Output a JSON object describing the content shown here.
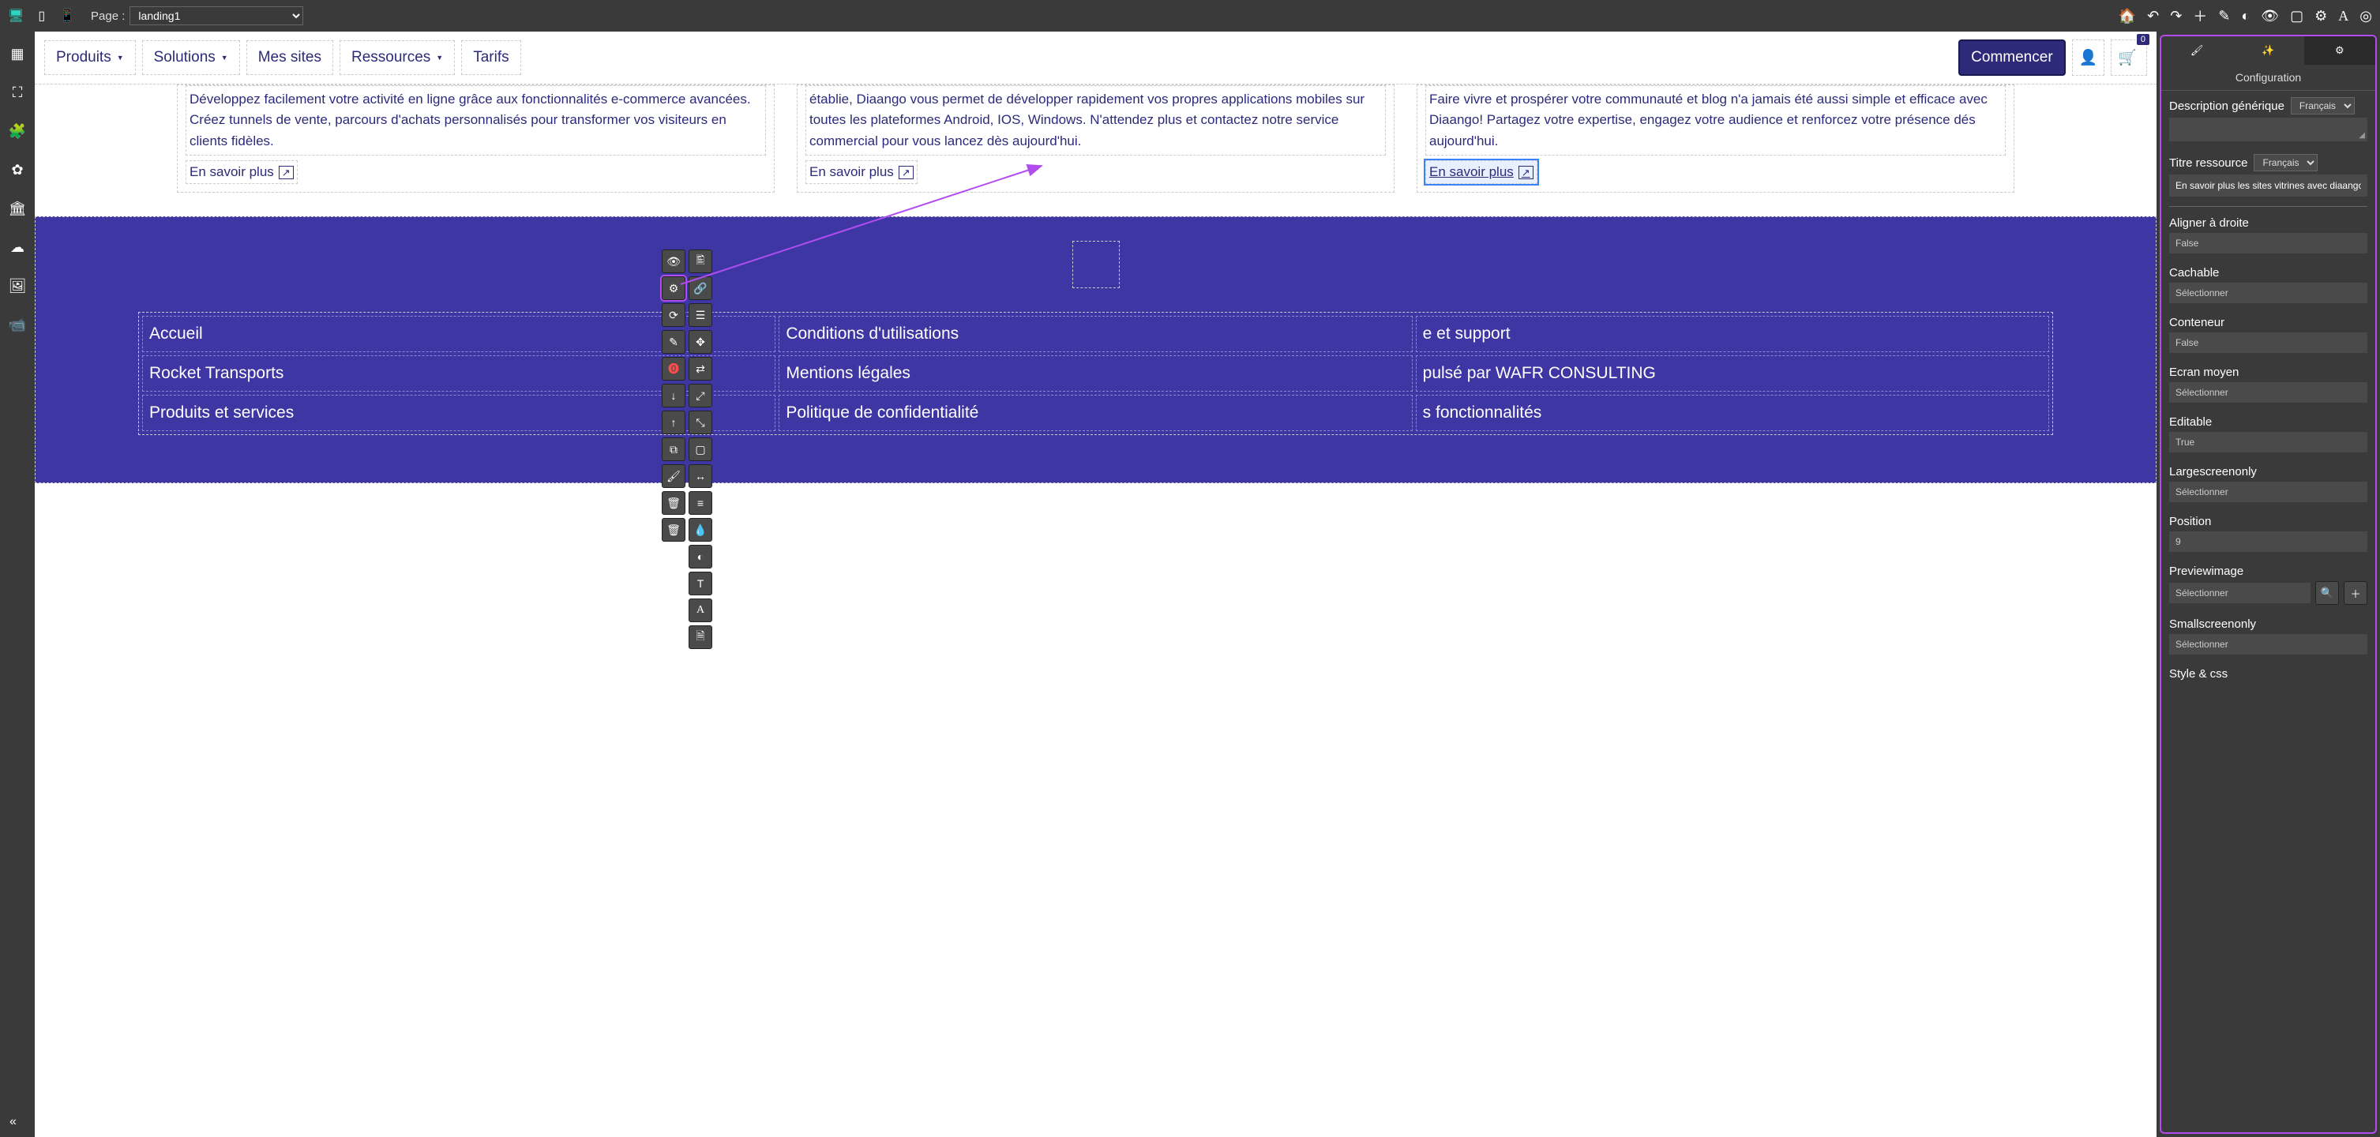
{
  "topbar": {
    "page_label": "Page :",
    "page_value": "landing1"
  },
  "nav": {
    "items": [
      "Produits",
      "Solutions",
      "Mes sites",
      "Ressources",
      "Tarifs"
    ],
    "cta": "Commencer",
    "badge": "0"
  },
  "cards": [
    {
      "text": "Développez facilement votre activité en ligne grâce aux fonctionnalités e-commerce avancées. Créez tunnels de vente, parcours d'achats personnalisés pour transformer vos visiteurs en clients fidèles.",
      "link": "En savoir plus"
    },
    {
      "text": "établie, Diaango vous permet de développer rapidement vos propres applications mobiles sur toutes les plateformes Android, IOS, Windows. N'attendez plus et  contactez notre service commercial pour vous lancez dès aujourd'hui.",
      "link": "En savoir plus"
    },
    {
      "text": "Faire vivre et prospérer votre communauté et blog n'a jamais été aussi simple et efficace avec Diaango! Partagez votre expertise, engagez votre audience et renforcez votre présence dés aujourd'hui.",
      "link": "En savoir plus"
    }
  ],
  "footer": {
    "col1": [
      "Accueil",
      "Rocket Transports",
      "Produits et services"
    ],
    "col2": [
      "Conditions d'utilisations",
      "Mentions légales",
      "Politique de confidentialité"
    ],
    "col3": [
      "e et support",
      "pulsé par WAFR CONSULTING",
      "s fonctionnalités"
    ]
  },
  "panel": {
    "header": "Configuration",
    "desc_label": "Description générique",
    "lang": "Français",
    "title_label": "Titre ressource",
    "title_value": "En savoir plus les sites vitrines avec diaango",
    "props": {
      "align_right": {
        "label": "Aligner à droite",
        "value": "False"
      },
      "cachable": {
        "label": "Cachable",
        "value": "Sélectionner"
      },
      "container": {
        "label": "Conteneur",
        "value": "False"
      },
      "medium": {
        "label": "Ecran moyen",
        "value": "Sélectionner"
      },
      "editable": {
        "label": "Editable",
        "value": "True"
      },
      "largescreen": {
        "label": "Largescreenonly",
        "value": "Sélectionner"
      },
      "position": {
        "label": "Position",
        "value": "9"
      },
      "preview": {
        "label": "Previewimage",
        "value": "Sélectionner"
      },
      "smallscreen": {
        "label": "Smallscreenonly",
        "value": "Sélectionner"
      },
      "style": {
        "label": "Style & css"
      }
    }
  }
}
